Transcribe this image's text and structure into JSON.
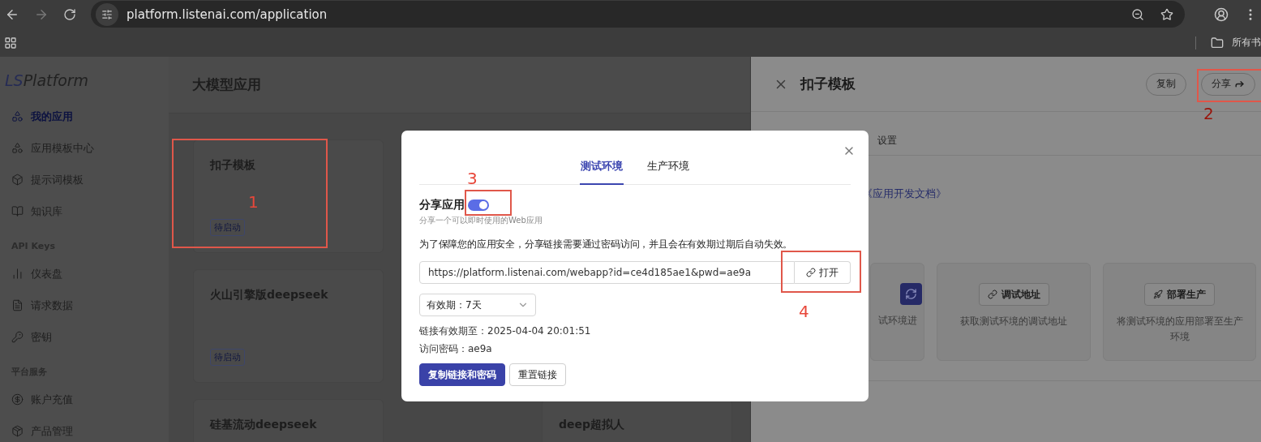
{
  "browser": {
    "url": "platform.listenai.com/application",
    "bookmarks_folder": "所有书"
  },
  "sidebar": {
    "logo": {
      "mark": "LS",
      "name": "Platform"
    },
    "groups": [
      {
        "items": [
          {
            "label": "我的应用",
            "selected": true
          },
          {
            "label": "应用模板中心",
            "selected": false
          },
          {
            "label": "提示词模板",
            "selected": false
          },
          {
            "label": "知识库",
            "selected": false
          }
        ]
      },
      {
        "heading": "API Keys",
        "items": [
          {
            "label": "仪表盘",
            "selected": false
          },
          {
            "label": "请求数据",
            "selected": false
          },
          {
            "label": "密钥",
            "selected": false
          }
        ]
      },
      {
        "heading": "平台服务",
        "items": [
          {
            "label": "账户充值",
            "selected": false
          },
          {
            "label": "产品管理",
            "selected": false
          }
        ]
      }
    ]
  },
  "main": {
    "title": "大模型应用",
    "card_columns": [
      [
        {
          "title": "扣子模板",
          "status": "待启动"
        },
        {
          "title": "火山引擎版deepseek",
          "status": "待启动"
        },
        {
          "title": "硅基流动deepseek"
        }
      ],
      [
        {
          "title": "deep超拟人"
        }
      ]
    ]
  },
  "drawer": {
    "title": "扣子模板",
    "actions": [
      {
        "label": "复制",
        "kind": "plain"
      },
      {
        "label": "分享",
        "kind": "share"
      }
    ],
    "tabs": [
      {
        "label": "设置",
        "selected": false
      }
    ],
    "doc_link": "《应用开发文档》",
    "cards": [
      {
        "kind": "refresh",
        "text": "试环境进"
      },
      {
        "kind": "debug",
        "button": "调试地址",
        "text": "获取测试环境的调试地址"
      },
      {
        "kind": "deploy",
        "button": "部署生产",
        "text": "将测试环境的应用部署至生产环境"
      }
    ]
  },
  "share_dialog": {
    "tabs": [
      {
        "label": "测试环境",
        "selected": true
      },
      {
        "label": "生产环境",
        "selected": false
      }
    ],
    "toggle": {
      "label": "分享应用",
      "on": true,
      "hint": "分享一个可以即时使用的Web应用"
    },
    "notice": "为了保障您的应用安全，分享链接需要通过密码访问，并且会在有效期过期后自动失效。",
    "url": "https://platform.listenai.com/webapp?id=ce4d185ae1&pwd=ae9a",
    "open_button": "打开",
    "validity": "有效期：7天",
    "expires": "链接有效期至：2025-04-04 20:01:51",
    "password": "访问密码：ae9a",
    "buttons": [
      {
        "label": "复制链接和密码",
        "kind": "primary"
      },
      {
        "label": "重置链接",
        "kind": "secondary"
      }
    ]
  },
  "annotations": [
    {
      "label": "1"
    },
    {
      "label": "2"
    },
    {
      "label": "3"
    },
    {
      "label": "4"
    }
  ]
}
